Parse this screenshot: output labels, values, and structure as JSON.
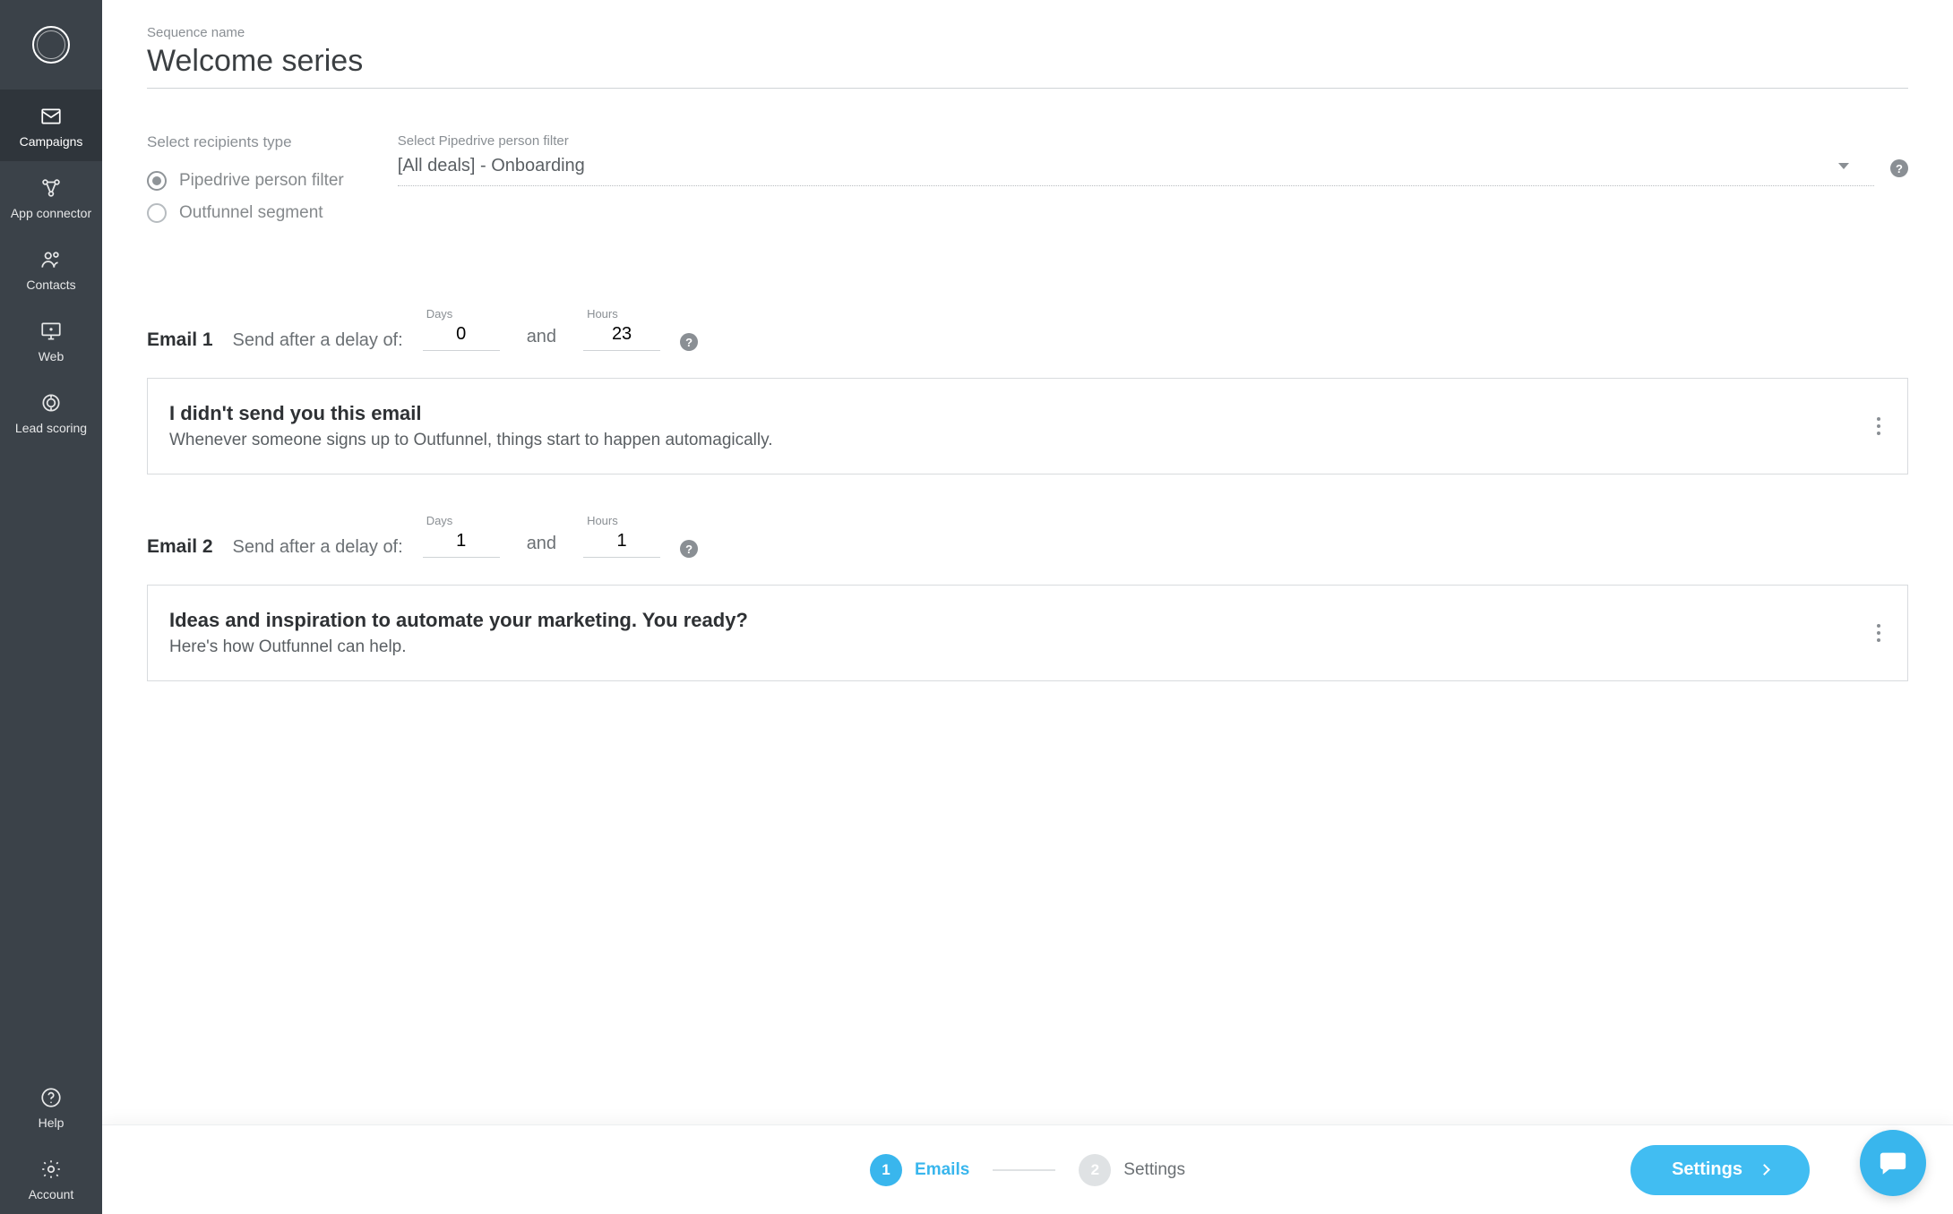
{
  "sidebar": {
    "items": [
      {
        "id": "campaigns",
        "label": "Campaigns",
        "active": true
      },
      {
        "id": "app-connector",
        "label": "App connector",
        "active": false
      },
      {
        "id": "contacts",
        "label": "Contacts",
        "active": false
      },
      {
        "id": "web",
        "label": "Web",
        "active": false
      },
      {
        "id": "lead-scoring",
        "label": "Lead scoring",
        "active": false
      }
    ],
    "bottomItems": [
      {
        "id": "help",
        "label": "Help"
      },
      {
        "id": "account",
        "label": "Account"
      }
    ]
  },
  "sequence": {
    "nameLabel": "Sequence name",
    "name": "Welcome series"
  },
  "recipients": {
    "heading": "Select recipients type",
    "options": [
      {
        "id": "pipedrive-filter",
        "label": "Pipedrive person filter",
        "selected": true
      },
      {
        "id": "outfunnel-segment",
        "label": "Outfunnel segment",
        "selected": false
      }
    ],
    "filterLabel": "Select Pipedrive person filter",
    "filterValue": "[All deals] - Onboarding"
  },
  "delayLabels": {
    "days": "Days",
    "hours": "Hours",
    "sendAfter": "Send after a delay of:",
    "and": "and"
  },
  "emails": [
    {
      "heading": "Email 1",
      "days": "0",
      "hours": "23",
      "subject": "I didn't send you this email",
      "preview": "Whenever someone signs up to Outfunnel, things start to happen automagically."
    },
    {
      "heading": "Email 2",
      "days": "1",
      "hours": "1",
      "subject": "Ideas and inspiration to automate your marketing. You ready?",
      "preview": "Here's how Outfunnel can help."
    }
  ],
  "stepper": {
    "steps": [
      {
        "num": "1",
        "label": "Emails",
        "active": true
      },
      {
        "num": "2",
        "label": "Settings",
        "active": false
      }
    ],
    "nextButton": "Settings"
  }
}
